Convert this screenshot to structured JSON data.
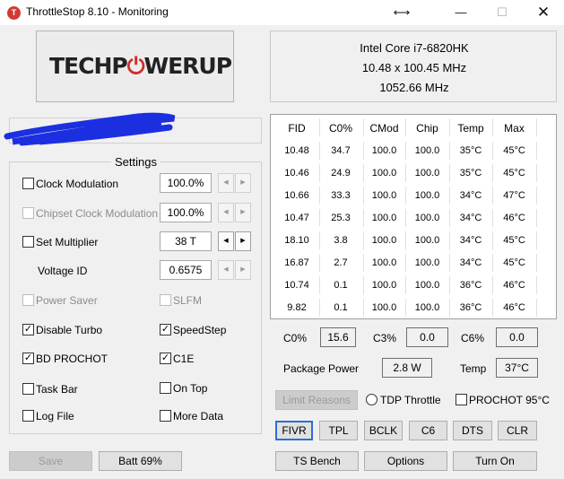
{
  "window": {
    "title": "ThrottleStop 8.10 - Monitoring",
    "app_icon": "T"
  },
  "logo": {
    "part1": "TECHP",
    "part2": "WERUP",
    "power_glyph": "⏻"
  },
  "cpu": {
    "name": "Intel Core i7-6820HK",
    "multiplier_line": "10.48 x 100.45 MHz",
    "freq": "1052.66 MHz"
  },
  "settings": {
    "title": "Settings",
    "clock_modulation": {
      "label": "Clock Modulation",
      "value": "100.0%",
      "checked": false
    },
    "chipset_clock_modulation": {
      "label": "Chipset Clock Modulation",
      "value": "100.0%",
      "checked": false
    },
    "set_multiplier": {
      "label": "Set Multiplier",
      "value": "38 T",
      "checked": false
    },
    "voltage_id": {
      "label": "Voltage ID",
      "value": "0.6575"
    },
    "power_saver": {
      "label": "Power Saver",
      "checked": false
    },
    "slfm": {
      "label": "SLFM",
      "checked": false
    },
    "disable_turbo": {
      "label": "Disable Turbo",
      "checked": true
    },
    "speedstep": {
      "label": "SpeedStep",
      "checked": true
    },
    "bd_prochot": {
      "label": "BD PROCHOT",
      "checked": true
    },
    "c1e": {
      "label": "C1E",
      "checked": true
    },
    "task_bar": {
      "label": "Task Bar",
      "checked": false
    },
    "on_top": {
      "label": "On Top",
      "checked": false
    },
    "log_file": {
      "label": "Log File",
      "checked": false
    },
    "more_data": {
      "label": "More Data",
      "checked": false
    }
  },
  "table": {
    "headers": [
      "FID",
      "C0%",
      "CMod",
      "Chip",
      "Temp",
      "Max"
    ],
    "rows": [
      [
        "10.48",
        "34.7",
        "100.0",
        "100.0",
        "35°C",
        "45°C"
      ],
      [
        "10.46",
        "24.9",
        "100.0",
        "100.0",
        "35°C",
        "45°C"
      ],
      [
        "10.66",
        "33.3",
        "100.0",
        "100.0",
        "34°C",
        "47°C"
      ],
      [
        "10.47",
        "25.3",
        "100.0",
        "100.0",
        "34°C",
        "46°C"
      ],
      [
        "18.10",
        "3.8",
        "100.0",
        "100.0",
        "34°C",
        "45°C"
      ],
      [
        "16.87",
        "2.7",
        "100.0",
        "100.0",
        "34°C",
        "45°C"
      ],
      [
        "10.74",
        "0.1",
        "100.0",
        "100.0",
        "36°C",
        "46°C"
      ],
      [
        "9.82",
        "0.1",
        "100.0",
        "100.0",
        "36°C",
        "46°C"
      ]
    ]
  },
  "stats": {
    "c0_label": "C0%",
    "c0_value": "15.6",
    "c3_label": "C3%",
    "c3_value": "0.0",
    "c6_label": "C6%",
    "c6_value": "0.0",
    "pkg_label": "Package Power",
    "pkg_value": "2.8 W",
    "temp_label": "Temp",
    "temp_value": "37°C"
  },
  "buttons": {
    "limit_reasons": "Limit Reasons",
    "tdp_throttle": "TDP Throttle",
    "prochot": "PROCHOT 95°C",
    "fivr": "FIVR",
    "tpl": "TPL",
    "bclk": "BCLK",
    "c6": "C6",
    "dts": "DTS",
    "clr": "CLR",
    "save": "Save",
    "batt": "Batt 69%",
    "ts_bench": "TS Bench",
    "options": "Options",
    "turn_on": "Turn On"
  },
  "colors": {
    "accent": "#2b6fd6",
    "brand_red": "#c8322d",
    "scribble": "#1c2fe0"
  }
}
